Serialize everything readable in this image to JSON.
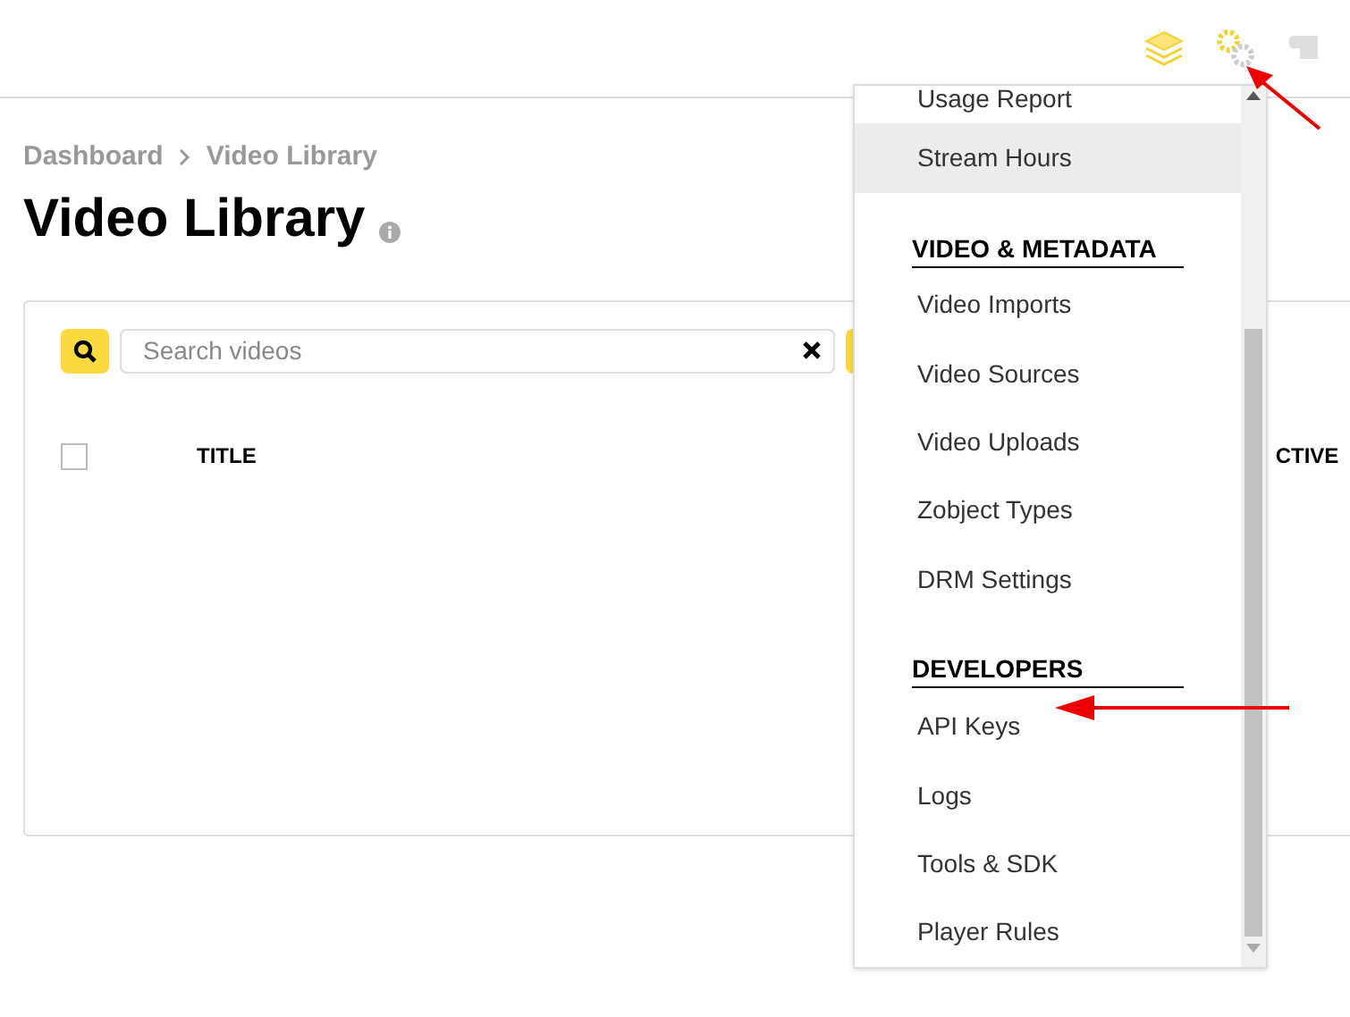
{
  "breadcrumb": [
    "Dashboard",
    "Video Library"
  ],
  "title": "Video Library",
  "search": {
    "placeholder": "Search videos"
  },
  "table": {
    "select_all": {
      "checked": false
    },
    "columns": [
      "TITLE",
      "CTIVE"
    ]
  },
  "menu": {
    "items": [
      {
        "kind": "item",
        "label": "Usage Report",
        "selected": false
      },
      {
        "kind": "item",
        "label": "Stream Hours",
        "selected": true
      },
      {
        "kind": "heading",
        "label": "VIDEO & METADATA"
      },
      {
        "kind": "item",
        "label": "Video Imports",
        "selected": false
      },
      {
        "kind": "item",
        "label": "Video Sources",
        "selected": false
      },
      {
        "kind": "item",
        "label": "Video Uploads",
        "selected": false
      },
      {
        "kind": "item",
        "label": "Zobject Types",
        "selected": false
      },
      {
        "kind": "item",
        "label": "DRM Settings",
        "selected": false
      },
      {
        "kind": "heading",
        "label": "DEVELOPERS"
      },
      {
        "kind": "item",
        "label": "API Keys",
        "selected": false
      },
      {
        "kind": "item",
        "label": "Logs",
        "selected": false
      },
      {
        "kind": "item",
        "label": "Tools & SDK",
        "selected": false
      },
      {
        "kind": "item",
        "label": "Player Rules",
        "selected": false
      }
    ]
  }
}
